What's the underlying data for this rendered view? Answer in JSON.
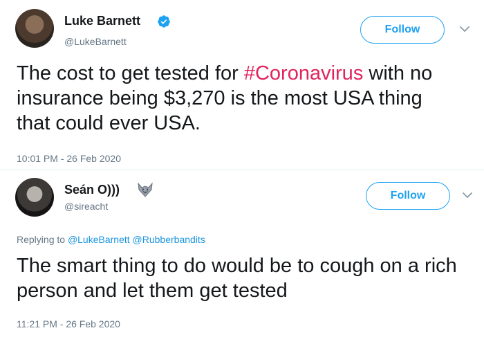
{
  "tweets": [
    {
      "display_name": "Luke Barnett",
      "handle": "@LukeBarnett",
      "verified": true,
      "follow_label": "Follow",
      "text_parts": [
        "The cost to get tested for ",
        "#Coronavirus",
        " with no insurance being $3,270 is the most USA thing that could ever USA."
      ],
      "timestamp": "10:01 PM - 26 Feb 2020"
    },
    {
      "display_name": "Seán O)))",
      "handle": "@sireacht",
      "follow_label": "Follow",
      "replying_label": "Replying to ",
      "replying_mentions": "@LukeBarnett @Rubberbandits",
      "text": "The smart thing to do would be to cough on a rich person and let them get tested",
      "timestamp": "11:21 PM - 26 Feb 2020"
    }
  ],
  "colors": {
    "accent": "#1da1f2",
    "hashtag": "#e0245e",
    "secondary_text": "#657786"
  },
  "icons": [
    "verified-icon",
    "fox-icon",
    "chevron-down-icon"
  ]
}
